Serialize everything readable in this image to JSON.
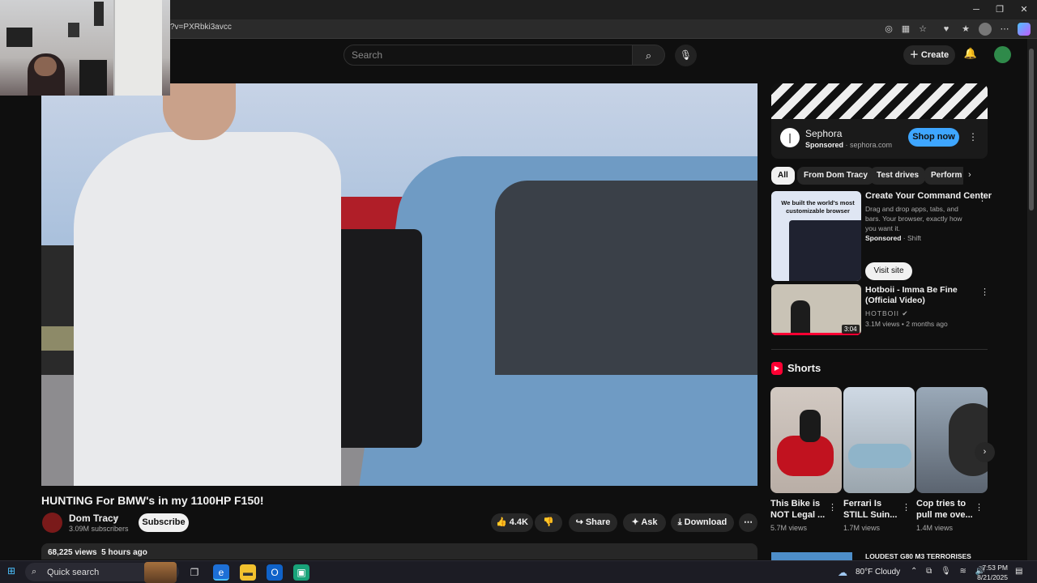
{
  "browser": {
    "url": "?v=PXRbki3avcc",
    "window_controls": {
      "minimize": "─",
      "restore": "❐",
      "close": "✕"
    },
    "toolbar_icons": [
      "tracking-icon",
      "extensions-icon",
      "favorite-icon",
      "browser-essentials-icon",
      "favorites-icon",
      "profile-icon",
      "more-icon",
      "copilot-icon"
    ]
  },
  "header": {
    "search_placeholder": "Search",
    "create_label": "Create"
  },
  "video": {
    "title": "HUNTING For BMW's in my 1100HP F150!",
    "channel": "Dom Tracy",
    "subscribers": "3.09M subscribers",
    "subscribe_label": "Subscribe",
    "likes": "4.4K",
    "share_label": "Share",
    "ask_label": "Ask",
    "download_label": "Download",
    "views": "68,225 views",
    "posted": "5 hours ago"
  },
  "ad": {
    "name": "Sephora",
    "sponsored": "Sponsored",
    "domain": "sephora.com",
    "cta": "Shop now"
  },
  "chips": [
    "All",
    "From Dom Tracy",
    "Test drives",
    "Perform"
  ],
  "sponsored_card": {
    "thumb_text": "We built the world's most customizable browser",
    "title": "Create Your Command Center",
    "description": "Drag and drop apps, tabs, and bars. Your browser, exactly how you want it.",
    "sponsored": "Sponsored",
    "advertiser": "Shift",
    "cta": "Visit site"
  },
  "related": {
    "title": "Hotboii - Imma Be Fine (Official Video)",
    "channel": "HOTBOII",
    "views": "3.1M views",
    "age": "2 months ago",
    "duration": "3:04"
  },
  "shorts": {
    "label": "Shorts",
    "items": [
      {
        "title": "This Bike is NOT Legal ...",
        "views": "5.7M views"
      },
      {
        "title": "Ferrari Is STILL Suin...",
        "views": "1.7M views"
      },
      {
        "title": "Cop tries to pull me ove...",
        "views": "1.4M views"
      }
    ]
  },
  "next_item_title": "LOUDEST G80 M3 TERRORISES",
  "taskbar": {
    "search_label": "Quick search",
    "weather": "80°F  Cloudy",
    "time": "7:53 PM",
    "date": "8/21/2025"
  }
}
